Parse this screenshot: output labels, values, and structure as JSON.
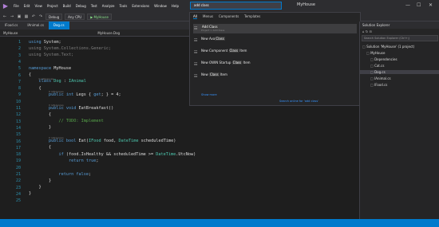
{
  "menubar": {
    "logo_label": "VS",
    "items": [
      "File",
      "Edit",
      "View",
      "Project",
      "Build",
      "Debug",
      "Test",
      "Analyze",
      "Tools",
      "Extensions",
      "Window",
      "Help"
    ],
    "search_value": "add class",
    "solution_name": "MyHouse",
    "window_buttons": [
      "—",
      "☐",
      "✕"
    ]
  },
  "toolbar": {
    "config": "Debug",
    "platform": "Any CPU",
    "run_target": "▶ MyHouse"
  },
  "tabs": [
    {
      "label": "IFood.cs"
    },
    {
      "label": "IAnimal.cs"
    },
    {
      "label": "Dog.cs"
    }
  ],
  "navbar": {
    "project": "MyHouse",
    "type": "MyHouse.Dog",
    "member": ""
  },
  "editor": {
    "lines": [
      {
        "n": "1",
        "hint": "",
        "code": [
          {
            "c": "using",
            "k": "kw"
          },
          {
            "c": " System;"
          }
        ]
      },
      {
        "n": "2",
        "hint": "",
        "code": [
          {
            "c": "using System.Collections.Generic;",
            "k": "gr"
          }
        ]
      },
      {
        "n": "3",
        "hint": "",
        "code": [
          {
            "c": "using System.Text;",
            "k": "gr"
          }
        ]
      },
      {
        "n": "4",
        "hint": "",
        "code": []
      },
      {
        "n": "5",
        "hint": "",
        "code": [
          {
            "c": "namespace",
            "k": "kw"
          },
          {
            "c": " MyHouse"
          }
        ]
      },
      {
        "n": "6",
        "hint": "",
        "code": [
          {
            "c": "{"
          }
        ]
      },
      {
        "n": "7",
        "hint": "0 references",
        "code": [
          {
            "c": "    "
          },
          {
            "c": "class",
            "k": "kw"
          },
          {
            "c": " "
          },
          {
            "c": "Dog",
            "k": "ty"
          },
          {
            "c": " : "
          },
          {
            "c": "IAnimal",
            "k": "ty"
          }
        ]
      },
      {
        "n": "8",
        "hint": "",
        "code": [
          {
            "c": "    {"
          }
        ]
      },
      {
        "n": "9",
        "hint": "0 references",
        "code": [
          {
            "c": "        "
          },
          {
            "c": "public",
            "k": "kw"
          },
          {
            "c": " "
          },
          {
            "c": "int",
            "k": "kw"
          },
          {
            "c": " Legs { "
          },
          {
            "c": "get",
            "k": "kw"
          },
          {
            "c": "; } = 4;"
          }
        ]
      },
      {
        "n": "10",
        "hint": "",
        "code": []
      },
      {
        "n": "11",
        "hint": "0 references",
        "code": [
          {
            "c": "        "
          },
          {
            "c": "public",
            "k": "kw"
          },
          {
            "c": " "
          },
          {
            "c": "void",
            "k": "kw"
          },
          {
            "c": " EatBreakfast()"
          }
        ]
      },
      {
        "n": "12",
        "hint": "",
        "code": [
          {
            "c": "        {"
          }
        ]
      },
      {
        "n": "13",
        "hint": "",
        "code": [
          {
            "c": "            "
          },
          {
            "c": "// TODO: Implement",
            "k": "cm"
          }
        ]
      },
      {
        "n": "14",
        "hint": "",
        "code": [
          {
            "c": "        }"
          }
        ]
      },
      {
        "n": "15",
        "hint": "",
        "code": []
      },
      {
        "n": "16",
        "hint": "0 references",
        "code": [
          {
            "c": "        "
          },
          {
            "c": "public",
            "k": "kw"
          },
          {
            "c": " "
          },
          {
            "c": "bool",
            "k": "kw"
          },
          {
            "c": " Eat("
          },
          {
            "c": "IFood",
            "k": "ty"
          },
          {
            "c": " food, "
          },
          {
            "c": "DateTime",
            "k": "ty"
          },
          {
            "c": " scheduledTime)"
          }
        ]
      },
      {
        "n": "17",
        "hint": "",
        "code": [
          {
            "c": "        {"
          }
        ]
      },
      {
        "n": "18",
        "hint": "",
        "code": [
          {
            "c": "            "
          },
          {
            "c": "if",
            "k": "kw"
          },
          {
            "c": " (food.IsHealthy && scheduledTime >= "
          },
          {
            "c": "DateTime",
            "k": "ty"
          },
          {
            "c": ".UtcNow)"
          }
        ]
      },
      {
        "n": "19",
        "hint": "",
        "code": [
          {
            "c": "                "
          },
          {
            "c": "return",
            "k": "kw"
          },
          {
            "c": " "
          },
          {
            "c": "true",
            "k": "kw"
          },
          {
            "c": ";"
          }
        ]
      },
      {
        "n": "20",
        "hint": "",
        "code": []
      },
      {
        "n": "21",
        "hint": "",
        "code": [
          {
            "c": "            "
          },
          {
            "c": "return",
            "k": "kw"
          },
          {
            "c": " "
          },
          {
            "c": "false",
            "k": "kw"
          },
          {
            "c": ";"
          }
        ]
      },
      {
        "n": "22",
        "hint": "",
        "code": [
          {
            "c": "        }"
          }
        ]
      },
      {
        "n": "23",
        "hint": "",
        "code": [
          {
            "c": "    }"
          }
        ]
      },
      {
        "n": "24",
        "hint": "",
        "code": [
          {
            "c": "}"
          }
        ]
      },
      {
        "n": "25",
        "hint": "",
        "code": []
      }
    ]
  },
  "search_popup": {
    "tabs": [
      "All",
      "Menus",
      "Components",
      "Templates"
    ],
    "results": [
      {
        "pre": "",
        "mark": "Add Class",
        "post": "",
        "sub": "Project > Add Class",
        "right": "",
        "icon": "add-icon"
      },
      {
        "pre": "New Ava",
        "mark": "Class",
        "post": "",
        "sub": "",
        "right": "",
        "icon": "class-icon"
      },
      {
        "pre": "New Component ",
        "mark": "Class",
        "post": " Item",
        "sub": "",
        "right": "",
        "icon": "class-icon"
      },
      {
        "pre": "New OWIN Startup ",
        "mark": "Class",
        "post": " Item",
        "sub": "",
        "right": "",
        "icon": "class-icon"
      },
      {
        "pre": "New ",
        "mark": "Class",
        "post": " Item",
        "sub": "",
        "right": "",
        "icon": "class-icon"
      }
    ],
    "show_more": "Show more",
    "search_online": "Search online for 'add class'"
  },
  "solution_explorer": {
    "title": "Solution Explorer",
    "search_placeholder": "Search Solution Explorer (Ctrl+;)",
    "items": [
      {
        "label": "Solution 'MyHouse' (1 project)",
        "indent": 0,
        "sel": false,
        "icon": "solution-icon"
      },
      {
        "label": "MyHouse",
        "indent": 1,
        "sel": false,
        "icon": "project-icon"
      },
      {
        "label": "Dependencies",
        "indent": 2,
        "sel": false,
        "icon": "dependencies-icon"
      },
      {
        "label": "Cat.cs",
        "indent": 2,
        "sel": false,
        "icon": "csharp-file-icon"
      },
      {
        "label": "Dog.cs",
        "indent": 2,
        "sel": true,
        "icon": "csharp-file-icon"
      },
      {
        "label": "IAnimal.cs",
        "indent": 2,
        "sel": false,
        "icon": "csharp-file-icon"
      },
      {
        "label": "IFood.cs",
        "indent": 2,
        "sel": false,
        "icon": "csharp-file-icon"
      }
    ]
  }
}
